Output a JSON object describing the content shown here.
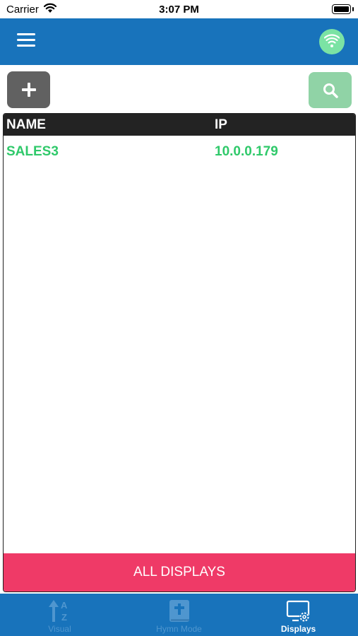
{
  "status_bar": {
    "carrier": "Carrier",
    "time": "3:07 PM"
  },
  "nav": {
    "menu_icon": "hamburger-menu-icon",
    "status_icon": "wifi-icon",
    "status_color": "#7be3a4",
    "bar_color": "#1873bb"
  },
  "toolbar": {
    "add_icon": "plus-icon",
    "search_icon": "search-icon"
  },
  "table": {
    "columns": [
      "NAME",
      "IP"
    ],
    "rows": [
      {
        "name": "SALES3",
        "ip": "10.0.0.179"
      }
    ],
    "row_text_color": "#2fc96a"
  },
  "footer_button": {
    "label": "ALL DISPLAYS",
    "color": "#ef3a67"
  },
  "tabs": [
    {
      "label": "Visual",
      "icon": "sort-az-icon",
      "active": false
    },
    {
      "label": "Hymn Mode",
      "icon": "bible-icon",
      "active": false
    },
    {
      "label": "Displays",
      "icon": "display-settings-icon",
      "active": true
    }
  ]
}
